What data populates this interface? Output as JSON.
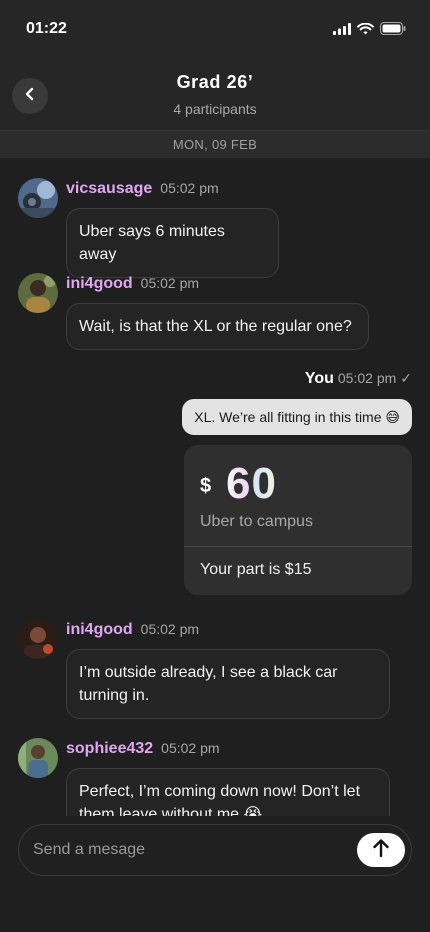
{
  "status_bar": {
    "time": "01:22",
    "icons": [
      "cellular-signal-icon",
      "wifi-icon",
      "battery-icon"
    ]
  },
  "header": {
    "title": "Grad 26’",
    "subtitle": "4 participants",
    "back_icon": "chevron-left-icon"
  },
  "date_separator": "MON, 09 FEB",
  "messages": [
    {
      "sender": "vicsausage",
      "time": "05:02 pm",
      "text": "Uber says 6 minutes away"
    },
    {
      "sender": "ini4good",
      "time": "05:02 pm",
      "text": "Wait, is that the XL or the regular one?"
    },
    {
      "sender": "You",
      "time": "05:02 pm",
      "status": "✓",
      "text": "XL. We’re all fitting in this time 😅"
    },
    {
      "sender": "ini4good",
      "time": "05:02 pm",
      "text": "I’m outside already, I see a black car turning in."
    },
    {
      "sender": "sophiee432",
      "time": "05:02 pm",
      "text": "Perfect, I’m coming down now! Don’t let them leave without me 😭"
    }
  ],
  "payment_card": {
    "currency": "$",
    "amount": "60",
    "description": "Uber to campus",
    "your_part": "Your part is $15"
  },
  "composer": {
    "placeholder": "Send a mesage",
    "send_icon": "arrow-up-icon"
  },
  "colors": {
    "background": "#1f1f1f",
    "sender_name": "#e0a6f2",
    "outgoing_bubble": "#e3e3e3",
    "card": "#2f2f2f"
  }
}
